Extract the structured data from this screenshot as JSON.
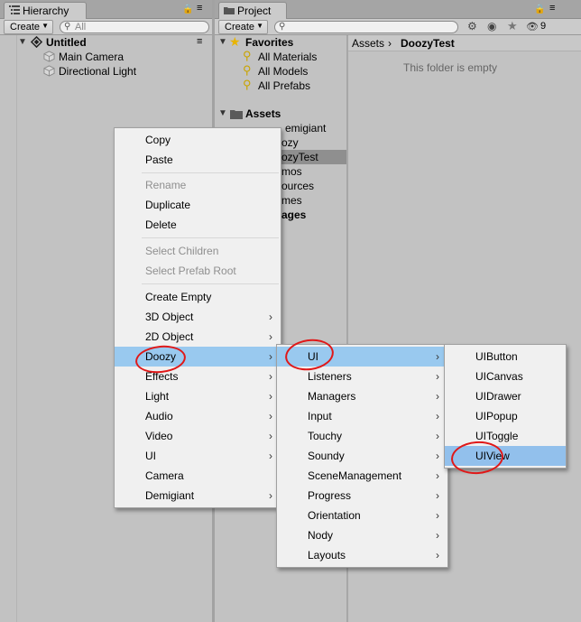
{
  "hierarchy": {
    "tab_label": "Hierarchy",
    "create_label": "Create",
    "search_placeholder": "All",
    "scene_name": "Untitled",
    "items": [
      "Main Camera",
      "Directional Light"
    ]
  },
  "project": {
    "tab_label": "Project",
    "create_label": "Create",
    "hidden_count": "9",
    "favorites_label": "Favorites",
    "favorites": [
      "All Materials",
      "All Models",
      "All Prefabs"
    ],
    "assets_label": "Assets",
    "asset_folders_visible": [
      "emigiant",
      "ozy",
      "ozyTest",
      "mos",
      "ources",
      "mes",
      "ages"
    ],
    "breadcrumb": [
      "Assets",
      "DoozyTest"
    ],
    "empty_message": "This folder is empty"
  },
  "context_menu": {
    "items": [
      {
        "label": "Copy",
        "disabled": false
      },
      {
        "label": "Paste",
        "disabled": false
      },
      {
        "label": "Rename",
        "disabled": true
      },
      {
        "label": "Duplicate",
        "disabled": false
      },
      {
        "label": "Delete",
        "disabled": false
      },
      {
        "label": "Select Children",
        "disabled": true
      },
      {
        "label": "Select Prefab Root",
        "disabled": true
      },
      {
        "label": "Create Empty",
        "disabled": false
      },
      {
        "label": "3D Object",
        "disabled": false
      },
      {
        "label": "2D Object",
        "disabled": false
      },
      {
        "label": "Doozy",
        "disabled": false
      },
      {
        "label": "Effects",
        "disabled": false
      },
      {
        "label": "Light",
        "disabled": false
      },
      {
        "label": "Audio",
        "disabled": false
      },
      {
        "label": "Video",
        "disabled": false
      },
      {
        "label": "UI",
        "disabled": false
      },
      {
        "label": "Camera",
        "disabled": false
      },
      {
        "label": "Demigiant",
        "disabled": false
      }
    ]
  },
  "doozy_menu": {
    "items": [
      "UI",
      "Listeners",
      "Managers",
      "Input",
      "Touchy",
      "Soundy",
      "SceneManagement",
      "Progress",
      "Orientation",
      "Nody",
      "Layouts"
    ]
  },
  "ui_menu": {
    "items": [
      "UIButton",
      "UICanvas",
      "UIDrawer",
      "UIPopup",
      "UIToggle",
      "UIView"
    ]
  },
  "submenu_arrow": "›",
  "colors": {
    "highlight": "#99c9ef",
    "annotation": "#e01818",
    "panel_bg": "#c2c2c2"
  }
}
